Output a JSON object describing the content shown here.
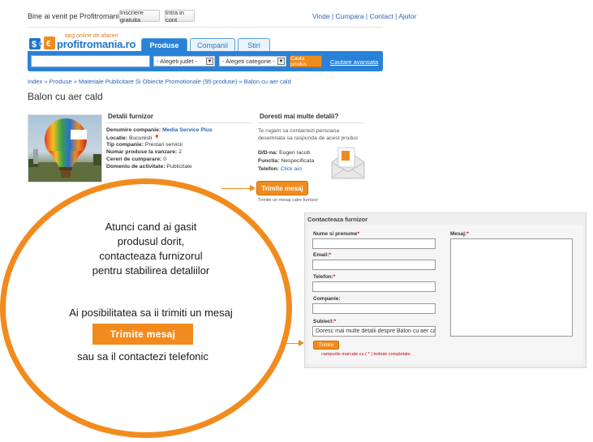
{
  "topbar": {
    "welcome": "Bine ai venit pe Profitromania.ro!",
    "register": "Inscriere gratuita",
    "login": "Intra in cont",
    "links": [
      "Vinde",
      "Cumpara",
      "Contact",
      "Ajutor"
    ]
  },
  "logo": {
    "tagline": "targ online de afaceri",
    "name": "profitromania.ro"
  },
  "tabs": [
    "Produse",
    "Companii",
    "Stiri"
  ],
  "search": {
    "judet": "- Alegeti judet -",
    "categorie": "- Alegeti categorie -",
    "button": "Cauta produs",
    "advanced": "Cautare avansata"
  },
  "breadcrumb": "Index » Produse » Materiale Publicitare Si Obiecte Promotionale (95 produse) » Balon cu aer cald",
  "page_title": "Balon cu aer cald",
  "details": {
    "header": "Detalii furnizor",
    "rows": [
      {
        "label": "Denumire companie:",
        "value": "Media Service Plus",
        "link": true
      },
      {
        "label": "Locatie:",
        "value": "Bucuresti",
        "link": false
      },
      {
        "label": "Tip companie:",
        "value": "Prestari servicii",
        "link": false
      },
      {
        "label": "Numar produse la vanzare:",
        "value": "2",
        "link": false
      },
      {
        "label": "Cereri de cumparare:",
        "value": "0",
        "link": false
      },
      {
        "label": "Domeniu de activitate:",
        "value": "Publicitate",
        "link": false
      }
    ]
  },
  "contact": {
    "header": "Doresti mai multe detalii?",
    "desc": "Te rugam sa contactezi persoana desemnata sa raspunda de acest produs",
    "rows": [
      {
        "label": "D/D-na:",
        "value": "Eugen Iacob",
        "link": false
      },
      {
        "label": "Functia:",
        "value": "Nespecificata",
        "link": false
      },
      {
        "label": "Telefon:",
        "value": "Click aici",
        "link": true
      }
    ],
    "button": "Trimite mesaj",
    "hint": "Trimite un mesaj catre furnizor"
  },
  "circle": {
    "line1": "Atunci cand ai gasit",
    "line2": "produsul dorit,",
    "line3": "contacteaza furnizorul",
    "line4": "pentru stabilirea detaliilor",
    "line5": "Ai posibilitatea sa ii trimiti un mesaj",
    "button": "Trimite mesaj",
    "line6": "sau sa il contactezi telefonic"
  },
  "form": {
    "title": "Contacteaza furnizor",
    "fields": [
      {
        "label": "Nume si prenume",
        "req": "*"
      },
      {
        "label": "Email:",
        "req": "*"
      },
      {
        "label": "Telefon:",
        "req": "*"
      },
      {
        "label": "Companie:",
        "req": ""
      },
      {
        "label": "Subiect:",
        "req": "*"
      }
    ],
    "subject_value": "Doresc mai multe detalii despre Balon cu aer cald",
    "message_label": "Mesaj:",
    "message_req": "*",
    "submit": "Trimite",
    "required_note": "campurile marcate cu ( * ) trebuie completate"
  }
}
